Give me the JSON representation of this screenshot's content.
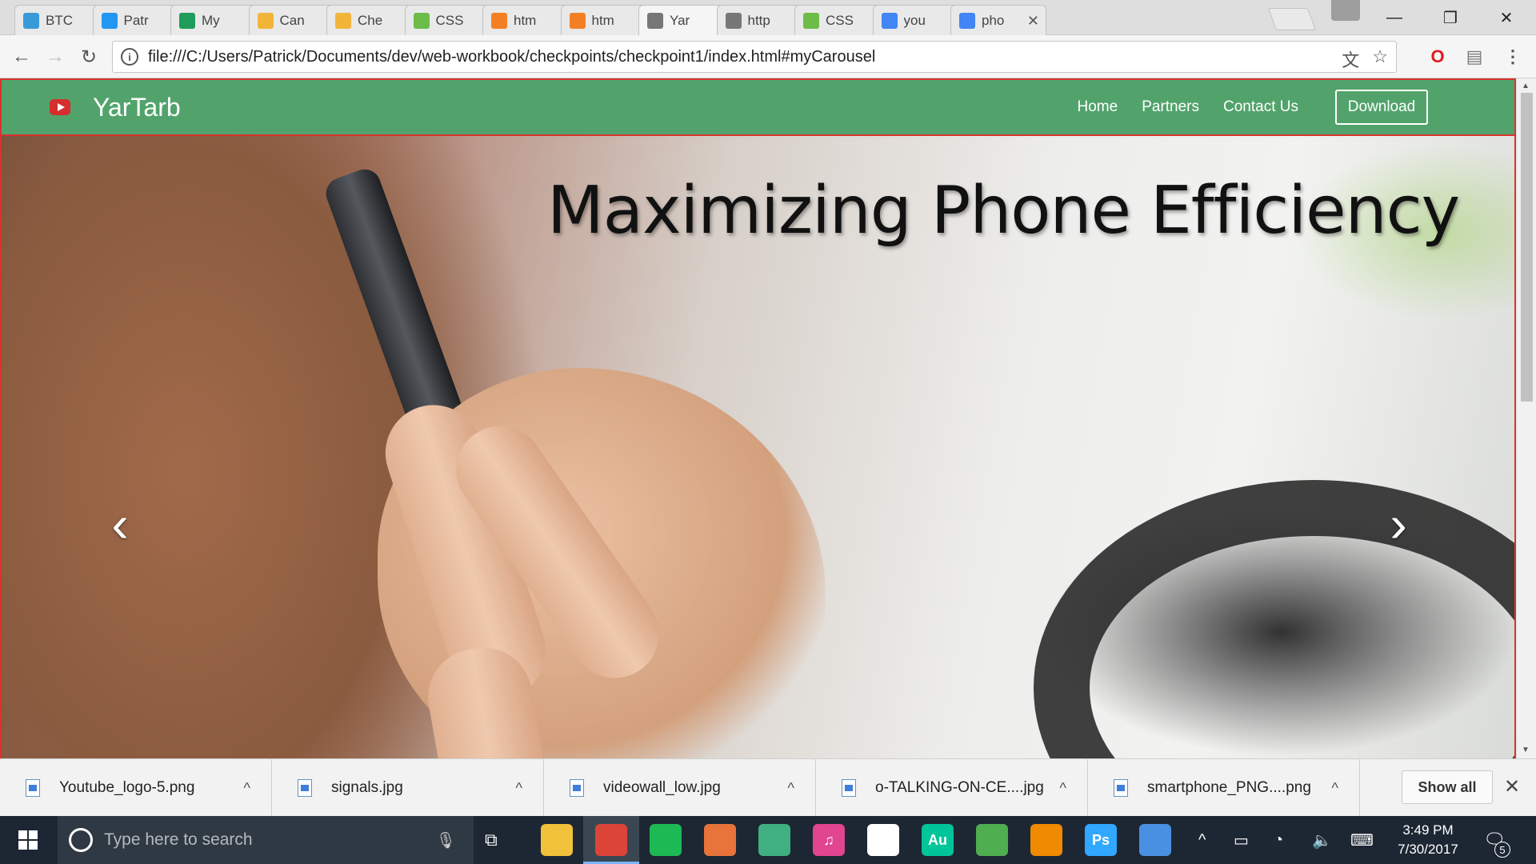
{
  "browser": {
    "tabs": [
      {
        "title": "BTC",
        "favicon_color": "#3a9ad9",
        "favicon": "cloud-icon",
        "close": "✕"
      },
      {
        "title": "Patr",
        "favicon_color": "#2196f3",
        "favicon": "bookmark-icon",
        "close": "✕"
      },
      {
        "title": "My",
        "favicon_color": "#1e9c5a",
        "favicon": "sheets-icon",
        "close": "✕"
      },
      {
        "title": "Can",
        "favicon_color": "#f2b53a",
        "favicon": "aca-icon",
        "close": "✕"
      },
      {
        "title": "Che",
        "favicon_color": "#f2b53a",
        "favicon": "aca-icon",
        "close": "✕"
      },
      {
        "title": "CSS",
        "favicon_color": "#6cbc4a",
        "favicon": "w3-icon",
        "close": "✕"
      },
      {
        "title": "htm",
        "favicon_color": "#f48024",
        "favicon": "stackoverflow-icon",
        "close": "✕"
      },
      {
        "title": "htm",
        "favicon_color": "#f48024",
        "favicon": "stackoverflow-icon",
        "close": "✕"
      },
      {
        "title": "Yar",
        "favicon_color": "#777777",
        "favicon": "page-icon",
        "close": "✕",
        "active": true
      },
      {
        "title": "http",
        "favicon_color": "#777777",
        "favicon": "page-icon",
        "close": "✕"
      },
      {
        "title": "CSS",
        "favicon_color": "#6cbc4a",
        "favicon": "w3-icon",
        "close": "✕"
      },
      {
        "title": "you",
        "favicon_color": "#4285f4",
        "favicon": "google-icon",
        "close": "✕"
      },
      {
        "title": "pho",
        "favicon_color": "#4285f4",
        "favicon": "google-icon",
        "close": "✕"
      }
    ],
    "window_controls": {
      "minimize": "—",
      "restore": "❐",
      "close": "✕"
    },
    "url": "file:///C:/Users/Patrick/Documents/dev/web-workbook/checkpoints/checkpoint1/index.html#myCarousel",
    "toolbar": {
      "back": "←",
      "forward": "→",
      "reload": "↻",
      "info": "i",
      "translate": "文",
      "star": "☆",
      "menu": "⋮"
    },
    "extensions": {
      "opera": "O",
      "reader": "▤"
    }
  },
  "site": {
    "brand": "YarTarb",
    "nav": [
      "Home",
      "Partners",
      "Contact Us"
    ],
    "download_label": "Download",
    "nav_color": "#52a36b",
    "hero_title": "Maximizing Phone Efficiency",
    "prev_arrow": "‹",
    "next_arrow": "›"
  },
  "downloads": {
    "items": [
      {
        "name": "Youtube_logo-5.png",
        "caret": "^"
      },
      {
        "name": "signals.jpg",
        "caret": "^"
      },
      {
        "name": "videowall_low.jpg",
        "caret": "^"
      },
      {
        "name": "o-TALKING-ON-CE....jpg",
        "caret": "^"
      },
      {
        "name": "smartphone_PNG....png",
        "caret": "^"
      }
    ],
    "show_all": "Show all",
    "close": "✕"
  },
  "taskbar": {
    "search_placeholder": "Type here to search",
    "apps": [
      {
        "name": "file-explorer-icon",
        "label": "",
        "color": "#f2c13a"
      },
      {
        "name": "chrome-icon",
        "label": "",
        "color": "#db4437",
        "active": true
      },
      {
        "name": "spotify-icon",
        "label": "",
        "color": "#1db954"
      },
      {
        "name": "git-icon",
        "label": "",
        "color": "#e8743b"
      },
      {
        "name": "atom-icon",
        "label": "",
        "color": "#40b080"
      },
      {
        "name": "itunes-icon",
        "label": "♫",
        "color": "#e1458f"
      },
      {
        "name": "photos-icon",
        "label": "",
        "color": "#ffffff"
      },
      {
        "name": "audition-icon",
        "label": "Au",
        "color": "#00c49a"
      },
      {
        "name": "maps-icon",
        "label": "",
        "color": "#4fae4f"
      },
      {
        "name": "vlc-icon",
        "label": "",
        "color": "#f08a00"
      },
      {
        "name": "photoshop-icon",
        "label": "Ps",
        "color": "#31a8ff"
      },
      {
        "name": "image-viewer-icon",
        "label": "",
        "color": "#4a90e2"
      }
    ],
    "time": "3:49 PM",
    "date": "7/30/2017",
    "notification_count": "5"
  }
}
